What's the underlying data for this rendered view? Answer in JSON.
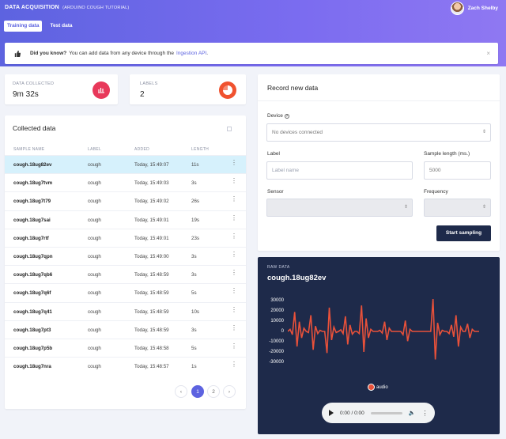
{
  "header": {
    "title": "DATA ACQUISITION",
    "subtitle": "(ARDUINO COUGH TUTORIAL)",
    "user_name": "Zach Shelby",
    "tabs": [
      {
        "label": "Training data",
        "active": true
      },
      {
        "label": "Test data",
        "active": false
      }
    ],
    "bg_color": "#6a68e8"
  },
  "notice": {
    "bold": "Did you know?",
    "text": "You can add data from any device through the",
    "link": "Ingestion API",
    "suffix": ".",
    "close": "×"
  },
  "stats": {
    "data_collected_label": "DATA COLLECTED",
    "data_collected_value": "9m 32s",
    "labels_label": "LABELS",
    "labels_value": "2",
    "data_icon_color": "#e8385a",
    "labels_icon_color": "#f0522f"
  },
  "collected": {
    "title": "Collected data",
    "columns": [
      "SAMPLE NAME",
      "LABEL",
      "ADDED",
      "LENGTH"
    ],
    "rows": [
      {
        "name": "cough.18ug82ev",
        "label": "cough",
        "added": "Today, 15:49:07",
        "length": "11s",
        "selected": true
      },
      {
        "name": "cough.18ug7tvm",
        "label": "cough",
        "added": "Today, 15:49:03",
        "length": "3s"
      },
      {
        "name": "cough.18ug7t79",
        "label": "cough",
        "added": "Today, 15:49:02",
        "length": "26s"
      },
      {
        "name": "cough.18ug7sai",
        "label": "cough",
        "added": "Today, 15:49:01",
        "length": "19s"
      },
      {
        "name": "cough.18ug7rtf",
        "label": "cough",
        "added": "Today, 15:49:01",
        "length": "23s"
      },
      {
        "name": "cough.18ug7qpn",
        "label": "cough",
        "added": "Today, 15:49:00",
        "length": "3s"
      },
      {
        "name": "cough.18ug7qb6",
        "label": "cough",
        "added": "Today, 15:48:59",
        "length": "3s"
      },
      {
        "name": "cough.18ug7q6f",
        "label": "cough",
        "added": "Today, 15:48:59",
        "length": "5s"
      },
      {
        "name": "cough.18ug7q41",
        "label": "cough",
        "added": "Today, 15:48:59",
        "length": "10s"
      },
      {
        "name": "cough.18ug7pt3",
        "label": "cough",
        "added": "Today, 15:48:59",
        "length": "3s"
      },
      {
        "name": "cough.18ug7p5b",
        "label": "cough",
        "added": "Today, 15:48:58",
        "length": "5s"
      },
      {
        "name": "cough.18ug7nra",
        "label": "cough",
        "added": "Today, 15:48:57",
        "length": "1s"
      }
    ],
    "pagination": {
      "prev": "‹",
      "pages": [
        "1",
        "2"
      ],
      "current": "1",
      "next": "›"
    }
  },
  "record": {
    "title": "Record new data",
    "device_label": "Device",
    "device_value": "No devices connected",
    "label_label": "Label",
    "label_placeholder": "Label name",
    "sample_length_label": "Sample length (ms.)",
    "sample_length_value": "5000",
    "sensor_label": "Sensor",
    "frequency_label": "Frequency",
    "start_button": "Start sampling"
  },
  "raw": {
    "label": "RAW DATA",
    "sample_name": "cough.18ug82ev",
    "y_ticks": [
      "30000",
      "20000",
      "10000",
      "0",
      "-10000",
      "-20000",
      "-30000"
    ],
    "legend": "audio",
    "series_color": "#e8513a",
    "player": {
      "time": "0:00 / 0:00"
    }
  },
  "chart_data": {
    "type": "line",
    "series": [
      {
        "name": "audio",
        "values": [
          0,
          2000,
          -3000,
          18000,
          -14000,
          9000,
          -6000,
          3000,
          0,
          -1000,
          15000,
          -17000,
          5000,
          -2000,
          1000,
          0,
          0,
          -20000,
          22000,
          -8000,
          4000,
          -1000,
          0,
          1500,
          -2000,
          14000,
          -12000,
          6000,
          -2500,
          0,
          0,
          -2000,
          24000,
          -19000,
          12000,
          -6000,
          2000,
          0,
          0,
          0,
          1000,
          -1500,
          9000,
          -8000,
          3000,
          0,
          0,
          0,
          0,
          0,
          -3000,
          10000,
          -9000,
          2000,
          0,
          0,
          0,
          0,
          0,
          0,
          0,
          0,
          0,
          30000,
          -26000,
          8000,
          -3000,
          1000,
          0,
          0,
          -2000,
          6000,
          -5000,
          15000,
          -14000,
          4000,
          0,
          0,
          7000,
          -6000,
          2000,
          0,
          0,
          0
        ]
      }
    ],
    "ylim": [
      -30000,
      30000
    ],
    "xlabel": "",
    "ylabel": ""
  }
}
